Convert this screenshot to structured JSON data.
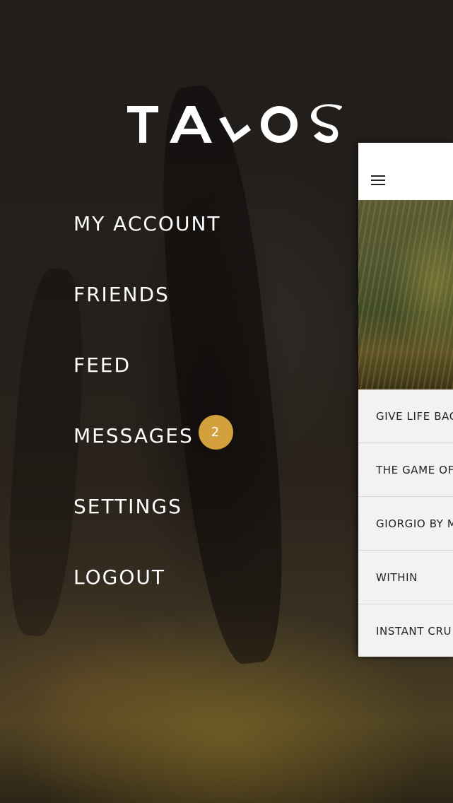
{
  "app": {
    "logo_text": "TALOS"
  },
  "menu": {
    "items": [
      {
        "label": "MY ACCOUNT"
      },
      {
        "label": "FRIENDS"
      },
      {
        "label": "FEED"
      },
      {
        "label": "MESSAGES",
        "badge": "2"
      },
      {
        "label": "SETTINGS"
      },
      {
        "label": "LOGOUT"
      }
    ]
  },
  "panel": {
    "menu_icon": "hamburger-icon",
    "list": [
      {
        "title": "GIVE LIFE BAC"
      },
      {
        "title": "THE GAME OF"
      },
      {
        "title": "GIORGIO BY M"
      },
      {
        "title": "WITHIN"
      },
      {
        "title": "INSTANT CRU"
      }
    ]
  },
  "colors": {
    "badge": "#d3a03e",
    "menu_text": "#ffffff",
    "panel_bg": "#f2f2f2",
    "list_text": "#222222"
  }
}
